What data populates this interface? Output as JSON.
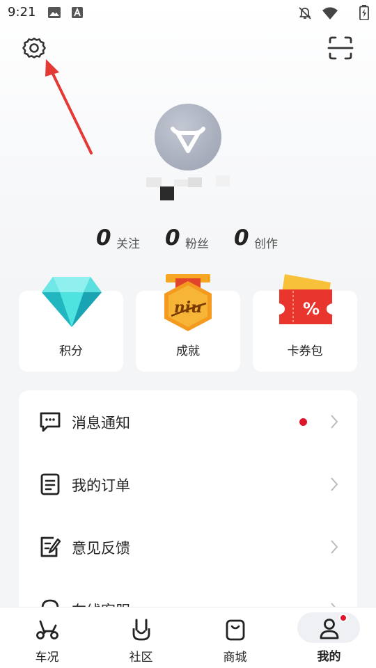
{
  "status_bar": {
    "time": "9:21",
    "icons": [
      "image-icon",
      "font-icon",
      "notifications-off-icon",
      "wifi-icon",
      "battery-charging-icon"
    ]
  },
  "header": {
    "left_icon": "settings-gear-icon",
    "right_icon": "scan-icon"
  },
  "profile": {
    "avatar_icon": "niu-bull-logo-icon"
  },
  "stats": [
    {
      "value": "0",
      "label": "关注"
    },
    {
      "value": "0",
      "label": "粉丝"
    },
    {
      "value": "0",
      "label": "创作"
    }
  ],
  "cards": [
    {
      "label": "积分",
      "icon": "diamond-icon"
    },
    {
      "label": "成就",
      "icon": "niu-medal-icon",
      "icon_text": "niu"
    },
    {
      "label": "卡券包",
      "icon": "coupon-icon",
      "icon_text": "%"
    }
  ],
  "menu": [
    {
      "label": "消息通知",
      "icon": "message-icon",
      "has_dot": true
    },
    {
      "label": "我的订单",
      "icon": "order-list-icon",
      "has_dot": false
    },
    {
      "label": "意见反馈",
      "icon": "feedback-edit-icon",
      "has_dot": false
    },
    {
      "label": "在线客服",
      "icon": "customer-service-icon",
      "has_dot": false
    }
  ],
  "bottom_nav": [
    {
      "label": "车况",
      "icon": "scooter-icon",
      "active": false
    },
    {
      "label": "社区",
      "icon": "rock-hand-icon",
      "active": false
    },
    {
      "label": "商城",
      "icon": "shopping-bag-icon",
      "active": false
    },
    {
      "label": "我的",
      "icon": "person-icon",
      "active": true,
      "badge": true
    }
  ],
  "colors": {
    "accent_red": "#e0162b",
    "annotation_arrow": "#e53935",
    "text_primary": "#222222",
    "background": "#f4f5f7"
  }
}
